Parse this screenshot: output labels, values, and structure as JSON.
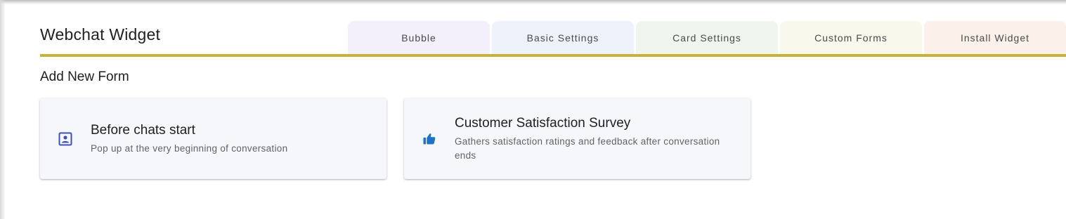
{
  "header": {
    "title": "Webchat Widget"
  },
  "tabs": [
    {
      "label": "Bubble",
      "color": "#f3effb"
    },
    {
      "label": "Basic Settings",
      "color": "#eef3fb"
    },
    {
      "label": "Card Settings",
      "color": "#f0f6ee"
    },
    {
      "label": "Custom Forms",
      "color": "#f9f8ec"
    },
    {
      "label": "Install Widget",
      "color": "#fbf0ea"
    }
  ],
  "accent_color": "#c9b236",
  "main": {
    "section_title": "Add New Form",
    "cards": [
      {
        "title": "Before chats start",
        "description": "Pop up at the very beginning of conversation",
        "icon": "contact-form-icon"
      },
      {
        "title": "Customer Satisfaction Survey",
        "description": "Gathers satisfaction ratings and feedback after conversation ends",
        "icon": "thumbs-up-icon"
      }
    ]
  }
}
